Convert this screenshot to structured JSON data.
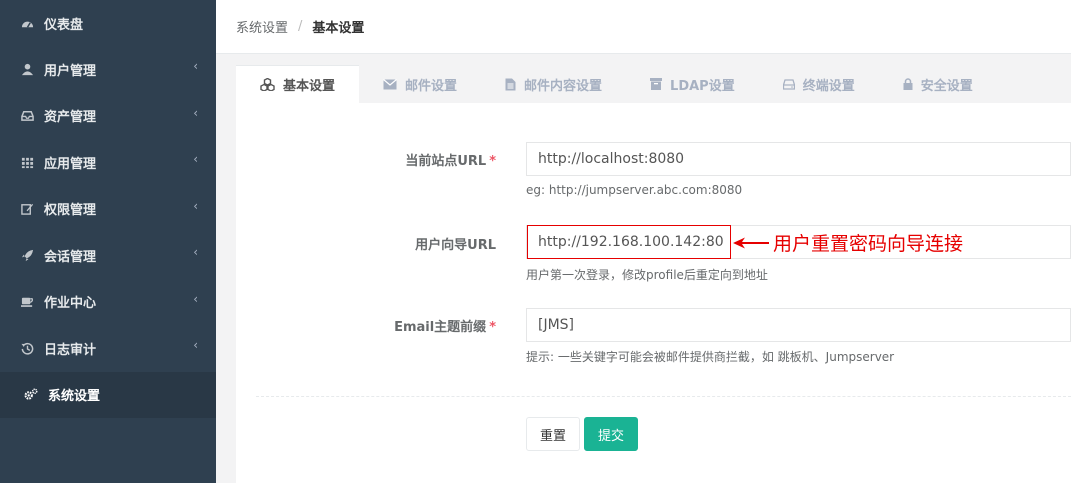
{
  "sidebar": {
    "items": [
      {
        "label": "仪表盘",
        "icon": "dashboard-icon",
        "has_arrow": false
      },
      {
        "label": "用户管理",
        "icon": "users-icon",
        "has_arrow": true
      },
      {
        "label": "资产管理",
        "icon": "inbox-icon",
        "has_arrow": true
      },
      {
        "label": "应用管理",
        "icon": "grid-icon",
        "has_arrow": true
      },
      {
        "label": "权限管理",
        "icon": "edit-icon",
        "has_arrow": true
      },
      {
        "label": "会话管理",
        "icon": "rocket-icon",
        "has_arrow": true
      },
      {
        "label": "作业中心",
        "icon": "coffee-icon",
        "has_arrow": true
      },
      {
        "label": "日志审计",
        "icon": "history-icon",
        "has_arrow": true
      },
      {
        "label": "系统设置",
        "icon": "cogs-icon",
        "has_arrow": false,
        "active": true
      }
    ],
    "arrow_glyph": "‹"
  },
  "breadcrumb": {
    "parent": "系统设置",
    "separator": "/",
    "current": "基本设置"
  },
  "tabs": [
    {
      "label": "基本设置",
      "icon": "cubes-icon",
      "active": true
    },
    {
      "label": "邮件设置",
      "icon": "envelope-icon"
    },
    {
      "label": "邮件内容设置",
      "icon": "file-icon"
    },
    {
      "label": "LDAP设置",
      "icon": "archive-icon"
    },
    {
      "label": "终端设置",
      "icon": "hdd-icon"
    },
    {
      "label": "安全设置",
      "icon": "lock-icon"
    }
  ],
  "form": {
    "site_url": {
      "label": "当前站点URL",
      "required_mark": "*",
      "value": "http://localhost:8080",
      "help": "eg: http://jumpserver.abc.com:8080"
    },
    "user_guide_url": {
      "label": "用户向导URL",
      "value": "http://192.168.100.142:80",
      "help": "用户第一次登录，修改profile后重定向到地址"
    },
    "email_prefix": {
      "label": "Email主题前缀",
      "required_mark": "*",
      "value": "[JMS]",
      "help": "提示: 一些关键字可能会被邮件提供商拦截，如 跳板机、Jumpserver"
    }
  },
  "annotation": {
    "text": "用户重置密码向导连接",
    "color": "#e60000"
  },
  "buttons": {
    "reset": "重置",
    "submit": "提交"
  },
  "colors": {
    "sidebar_bg": "#2f4050",
    "sidebar_active_bg": "#293846",
    "primary": "#1ab394",
    "required": "#ed5565"
  }
}
